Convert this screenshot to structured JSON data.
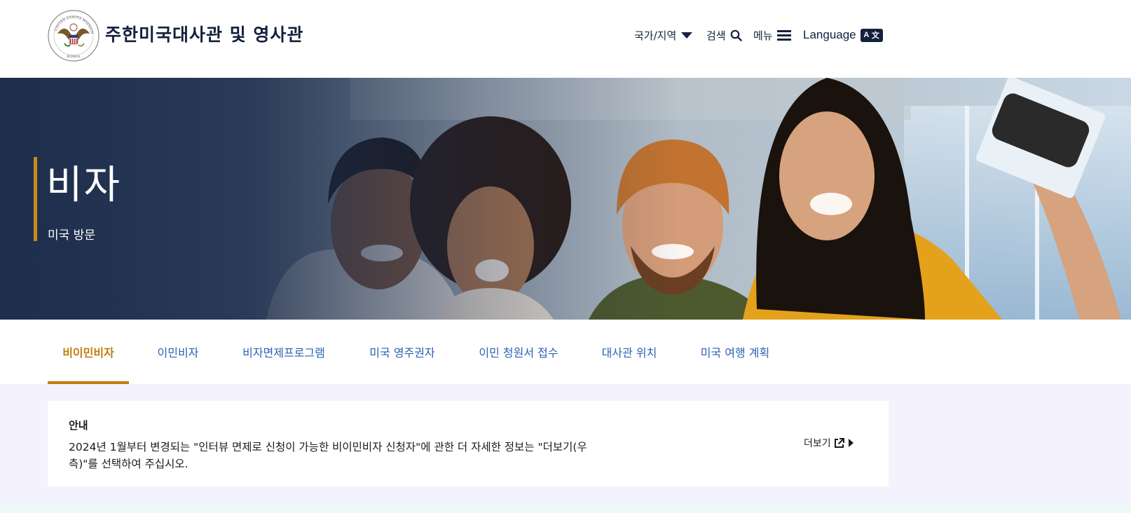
{
  "header": {
    "seal_text_top": "UNITED STATES MISSION",
    "seal_text_bottom": "KOREA",
    "site_title": "주한미국대사관 및 영사관",
    "nav": {
      "country_label": "국가/지역",
      "search_label": "검색",
      "menu_label": "메뉴",
      "language_label": "Language",
      "language_badge_left": "A",
      "language_badge_right": "文"
    }
  },
  "hero": {
    "title": "비자",
    "subtitle": "미국 방문",
    "accent_color": "#c98a1a"
  },
  "tabs": [
    {
      "label": "비이민비자",
      "active": true
    },
    {
      "label": "이민비자",
      "active": false
    },
    {
      "label": "비자면제프로그램",
      "active": false
    },
    {
      "label": "미국 영주권자",
      "active": false
    },
    {
      "label": "이민 청원서 접수",
      "active": false
    },
    {
      "label": "대사관 위치",
      "active": false
    },
    {
      "label": "미국 여행 계획",
      "active": false
    }
  ],
  "notice": {
    "title": "안내",
    "body": "2024년 1월부터 변경되는 \"인터뷰 면제로 신청이 가능한 비이민비자 신청자\"에 관한 더 자세한 정보는 \"더보기(우측)\"를 선택하여 주십시오.",
    "more_label": "더보기"
  },
  "colors": {
    "navy": "#14213d",
    "link_blue": "#2d61b5",
    "active_gold": "#c27c0e",
    "notice_bg": "#f4f2fc"
  }
}
